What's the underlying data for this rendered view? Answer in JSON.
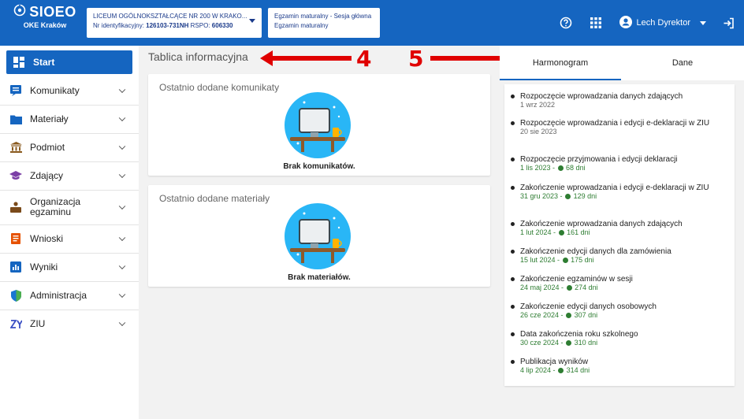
{
  "header": {
    "logo_title": "SIOEO",
    "logo_subtitle": "OKE Kraków",
    "school_name": "LICEUM OGÓLNOKSZTAŁCĄCE NR 200 W KRAKO...",
    "school_id_prefix": "Nr identyfikacyjny:",
    "school_id": "126103-731NH",
    "rspo_prefix": "RSPO:",
    "rspo": "606330",
    "exam_line1": "Egzamin maturalny - Sesja główna",
    "exam_line2": "Egzamin maturalny",
    "user_name": "Lech Dyrektor",
    "icons": [
      "help-circle-icon",
      "apps-grid-icon",
      "account-circle-icon",
      "logout-icon"
    ]
  },
  "sidebar": {
    "items": [
      {
        "label": "Start",
        "icon": "dashboard-icon",
        "active": true
      },
      {
        "label": "Komunikaty",
        "icon": "message-icon"
      },
      {
        "label": "Materiały",
        "icon": "folder-icon"
      },
      {
        "label": "Podmiot",
        "icon": "institution-icon"
      },
      {
        "label": "Zdający",
        "icon": "graduation-cap-icon"
      },
      {
        "label": "Organizacja",
        "label2": "egzaminu",
        "icon": "organization-icon"
      },
      {
        "label": "Wnioski",
        "icon": "document-icon"
      },
      {
        "label": "Wyniki",
        "icon": "chart-icon"
      },
      {
        "label": "Administracja",
        "icon": "shield-icon"
      },
      {
        "label": "ZIU",
        "icon": "ziu-icon"
      }
    ]
  },
  "main": {
    "title": "Tablica informacyjna",
    "cards": [
      {
        "title": "Ostatnio dodane komunikaty",
        "empty": "Brak komunikatów."
      },
      {
        "title": "Ostatnio dodane materiały",
        "empty": "Brak materiałów."
      }
    ]
  },
  "annotations": {
    "num4": "4",
    "num5": "5",
    "color": "#e00000"
  },
  "right_panel": {
    "tabs": [
      "Harmonogram",
      "Dane"
    ],
    "events": [
      {
        "title": "Rozpoczęcie wprowadzania danych zdających",
        "date": "1 wrz 2022",
        "days": ""
      },
      {
        "title": "Rozpoczęcie wprowadzania i edycji e-deklaracji w ZIU",
        "date": "20 sie 2023",
        "days": ""
      },
      {
        "title": "Rozpoczęcie przyjmowania i edycji deklaracji",
        "date": "1 lis 2023",
        "days": "68 dni"
      },
      {
        "title": "Zakończenie wprowadzania i edycji e-deklaracji w ZIU",
        "date": "31 gru 2023",
        "days": "129 dni"
      },
      {
        "title": "Zakończenie wprowadzania danych zdających",
        "date": "1 lut 2024",
        "days": "161 dni"
      },
      {
        "title": "Zakończenie edycji danych dla zamówienia",
        "date": "15 lut 2024",
        "days": "175 dni"
      },
      {
        "title": "Zakończenie egzaminów w sesji",
        "date": "24 maj 2024",
        "days": "274 dni"
      },
      {
        "title": "Zakończenie edycji danych osobowych",
        "date": "26 cze 2024",
        "days": "307 dni"
      },
      {
        "title": "Data zakończenia roku szkolnego",
        "date": "30 cze 2024",
        "days": "310 dni"
      },
      {
        "title": "Publikacja wyników",
        "date": "4 lip 2024",
        "days": "314 dni"
      }
    ]
  },
  "colors": {
    "primary": "#1565c0",
    "background": "#f2f2f2",
    "green": "#2e7d32"
  }
}
